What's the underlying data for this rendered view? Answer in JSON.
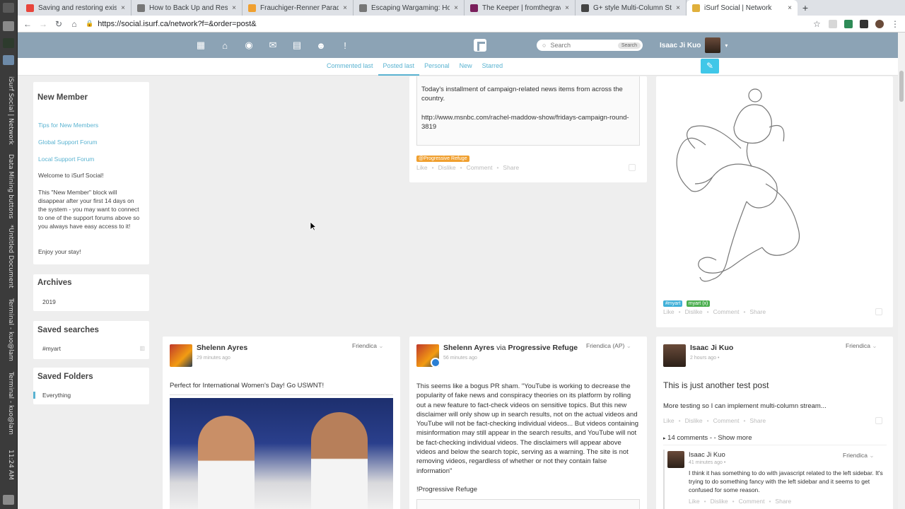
{
  "os": {
    "labels": [
      "iSurf Social | Network",
      "Data Mining buttons",
      "*Untitled Document",
      "Terminal - kuo@lam",
      "Terminal - kuo@lam",
      "11:24 AM"
    ]
  },
  "browser": {
    "tabs": [
      {
        "title": "Saving and restoring existi",
        "color": "#e8453c"
      },
      {
        "title": "How to Back Up and Restor",
        "color": "#777777"
      },
      {
        "title": "Frauchiger-Renner Paradox",
        "color": "#f0a030"
      },
      {
        "title": "Escaping Wargaming: How",
        "color": "#777777"
      },
      {
        "title": "The Keeper | fromthegrave",
        "color": "#7a1f5c"
      },
      {
        "title": "G+ style Multi-Column Stre",
        "color": "#444444"
      },
      {
        "title": "iSurf Social | Network",
        "color": "#e0b03c",
        "active": true
      }
    ],
    "close_glyph": "×",
    "new_tab_glyph": "+",
    "url": "https://social.isurf.ca/network?f=&order=post&"
  },
  "header": {
    "search_placeholder": "Search",
    "search_button": "Search",
    "user_name": "Isaac Ji Kuo"
  },
  "subnav": {
    "tabs": [
      {
        "label": "Commented last"
      },
      {
        "label": "Posted last",
        "active": true
      },
      {
        "label": "Personal"
      },
      {
        "label": "New"
      },
      {
        "label": "Starred"
      }
    ]
  },
  "sidebar": {
    "new_member": {
      "title": "New Member",
      "links": [
        "Tips for New Members",
        "Global Support Forum",
        "Local Support Forum"
      ],
      "welcome": "Welcome to iSurf Social!",
      "note": "This \"New Member\" block will disappear after your first 14 days on the system - you may want to connect to one of the support forums above so you always have easy access to it!",
      "enjoy": "Enjoy your stay!"
    },
    "archives": {
      "title": "Archives",
      "year": "2019"
    },
    "saved_searches": {
      "title": "Saved searches",
      "item": "#myart"
    },
    "saved_folders": {
      "title": "Saved Folders",
      "item": "Everything"
    }
  },
  "actions": {
    "like": "Like",
    "dislike": "Dislike",
    "comment": "Comment",
    "share": "Share"
  },
  "posts": {
    "msnbc": {
      "text1": "Today's installment of campaign-related news items from across the country.",
      "text2": "http://www.msnbc.com/rachel-maddow-show/fridays-campaign-round-3819",
      "tag": "@Progressive Refuge"
    },
    "art": {
      "tag1": "#myart",
      "tag2": "myart (x)"
    },
    "shelenn1": {
      "name": "Shelenn Ayres",
      "time": "29 minutes ago",
      "network": "Friendica",
      "text": "Perfect for International Women's Day! Go USWNT!"
    },
    "shelenn2": {
      "name": "Shelenn Ayres",
      "via": "via",
      "group": "Progressive Refuge",
      "time": "56 minutes ago",
      "network": "Friendica (AP)",
      "text": "This seems like a bogus PR sham. \"YouTube is working to decrease the popularity of fake news and conspiracy theories on its platform by rolling out a new feature to fact-check videos on sensitive topics. But this new disclaimer will only show up in search results, not on the actual videos and YouTube will not be fact-checking individual videos... But videos containing misinformation may still appear in the search results, and YouTube will not be fact-checking individual videos. The disclaimers will appear above videos and below the search topic, serving as a warning. The site is not removing videos, regardless of whether or not they contain false information\"",
      "footer": "!Progressive Refuge"
    },
    "isaac": {
      "name": "Isaac Ji Kuo",
      "time": "2 hours ago",
      "network": "Friendica",
      "title": "This is just another test post",
      "text": "More testing so I can implement multi-column stream...",
      "comments_toggle": "14 comments - - Show more",
      "comment": {
        "name": "Isaac Ji Kuo",
        "time": "41 minutes ago",
        "network": "Friendica",
        "text": "I think it has something to do with javascript related to the left sidebar. It's trying to do something fancy with the left sidebar and it seems to get confused for some reason."
      }
    }
  }
}
